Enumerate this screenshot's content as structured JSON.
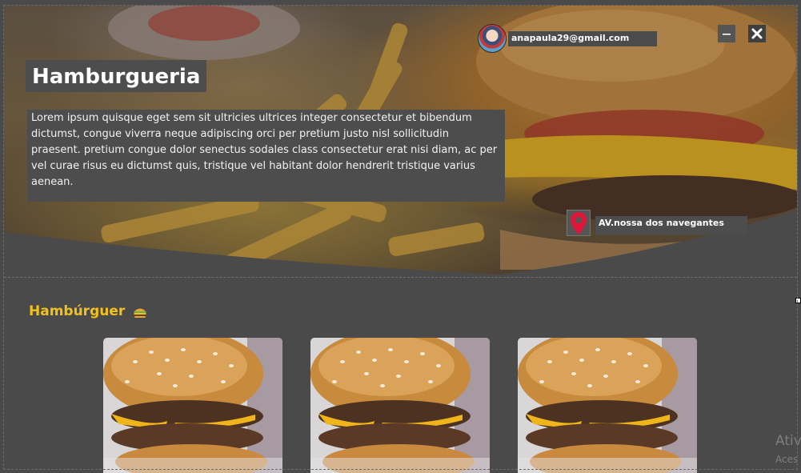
{
  "header": {
    "user_email": "anapaula29@gmail.com",
    "minimize_label": "minimize",
    "close_label": "close"
  },
  "hero": {
    "title": "Hamburgueria",
    "description": "Lorem ipsum quisque eget sem sit ultricies ultrices integer consectetur et bibendum dictumst, congue viverra neque adipiscing orci per pretium justo nisl sollicitudin praesent. pretium congue dolor senectus sodales class consectetur erat nisi diam, ac per vel curae risus eu dictumst quis, tristique vel habitant dolor hendrerit tristique varius aenean.",
    "address": "AV.nossa dos navegantes"
  },
  "section": {
    "title": "Hambúrguer",
    "icon": "hamburger-emoji-icon"
  },
  "products": [
    {
      "image": "burger-photo"
    },
    {
      "image": "burger-photo"
    },
    {
      "image": "burger-photo"
    }
  ],
  "watermark": {
    "line1": "Ativ",
    "line2": "Aces"
  },
  "colors": {
    "background": "#4a4a4a",
    "accent_yellow": "#f3c11b",
    "pin_red": "#e0153a",
    "text_box": "#4d4d4d"
  }
}
